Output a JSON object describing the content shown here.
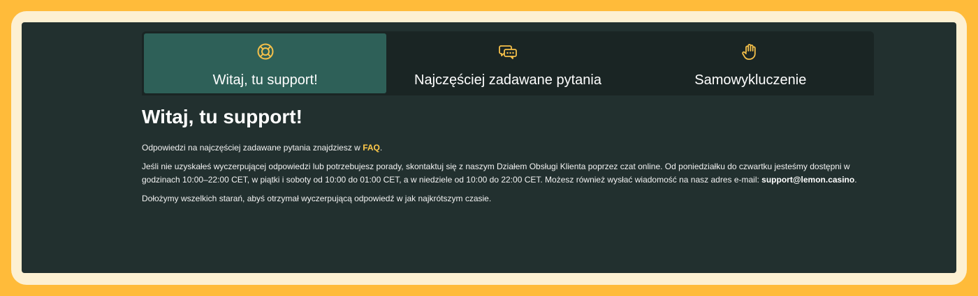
{
  "tabs": [
    {
      "label": "Witaj, tu support!",
      "icon": "lifebuoy-icon",
      "active": true
    },
    {
      "label": "Najczęściej zadawane pytania",
      "icon": "chat-bubbles-icon",
      "active": false
    },
    {
      "label": "Samowykluczenie",
      "icon": "stop-hand-icon",
      "active": false
    }
  ],
  "heading": "Witaj, tu support!",
  "paragraphs": {
    "p1_before": "Odpowiedzi na najczęściej zadawane pytania znajdziesz w ",
    "p1_link": "FAQ",
    "p1_after": ".",
    "p2_text": "Jeśli nie uzyskałeś wyczerpującej odpowiedzi lub potrzebujesz porady, skontaktuj się z naszym Działem Obsługi Klienta poprzez czat online. Od poniedziałku do czwartku jesteśmy dostępni w godzinach 10:00–22:00 CET, w piątki i soboty od 10:00 do 01:00 CET, a w niedziele od 10:00 do 22:00 CET. Możesz również wysłać wiadomość na nasz adres e-mail: ",
    "p2_email": "support@lemon.casino",
    "p2_after": ".",
    "p3_text": "Dołożymy wszelkich starań, abyś otrzymał wyczerpującą odpowiedź w jak najkrótszym czasie."
  },
  "colors": {
    "outer_border": "#ffbb3a",
    "panel_bg": "#22302f",
    "active_tab": "#2e6058",
    "icon_accent": "#f5c04a",
    "link": "#ffc94a"
  }
}
